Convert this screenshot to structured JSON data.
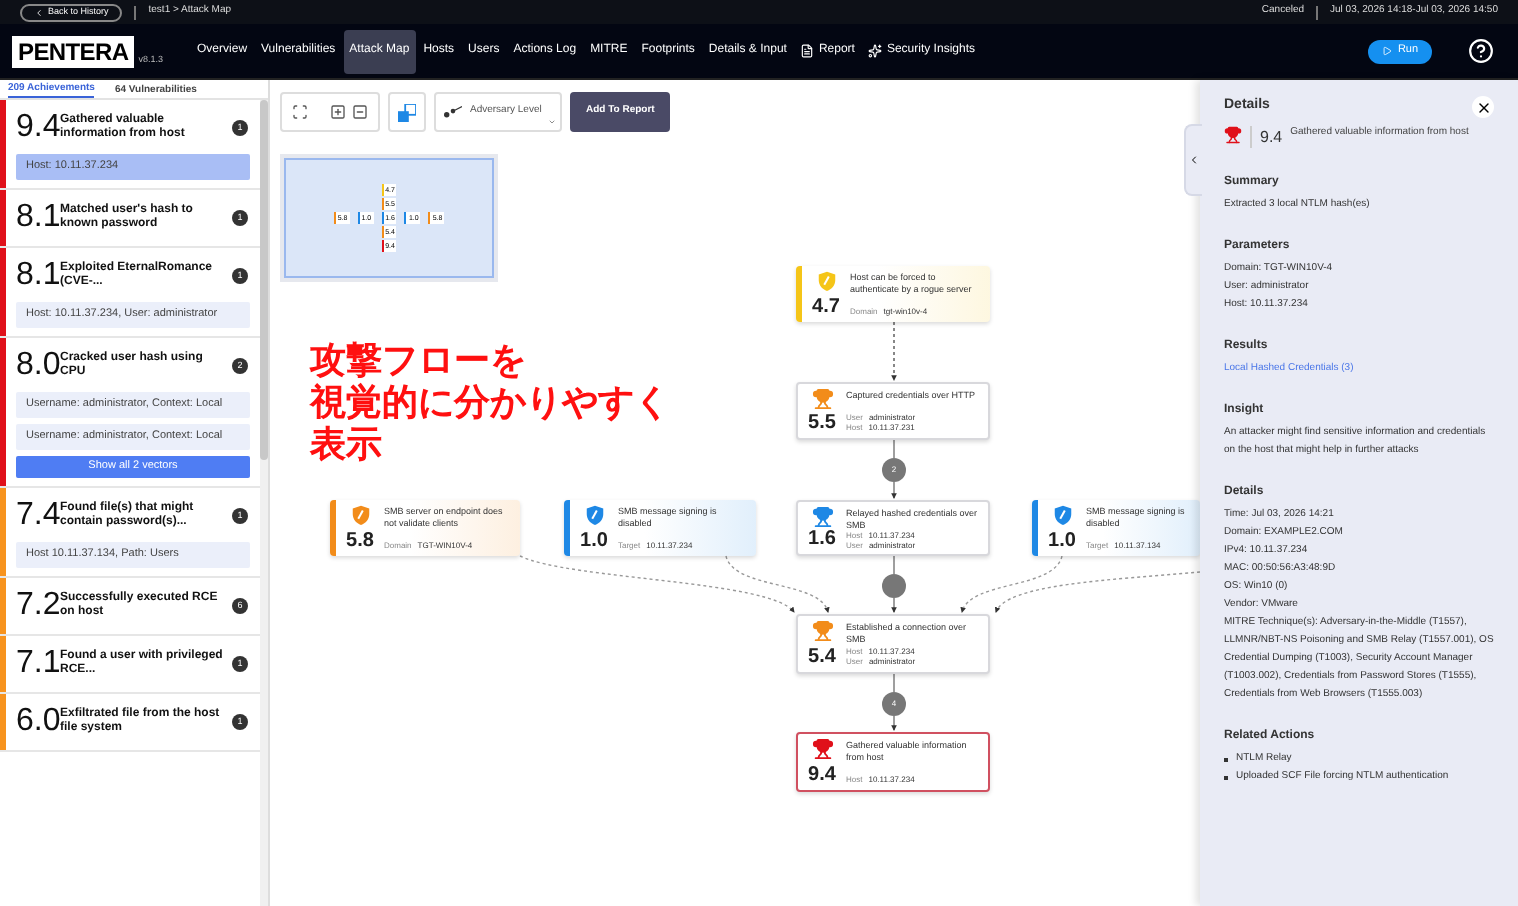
{
  "top_bar": {
    "back_button": "Back to History",
    "breadcrumb": "test1 > Attack Map",
    "status": "Canceled",
    "time_range": "Jul 03, 2026 14:18-Jul 03, 2026 14:50"
  },
  "nav": {
    "logo": "PENTERA",
    "version": "v8.1.3",
    "items": [
      {
        "label": "Overview",
        "selected": false,
        "kind": "plain"
      },
      {
        "label": "Vulnerabilities",
        "selected": false,
        "kind": "plain"
      },
      {
        "label": "Attack Map",
        "selected": true,
        "kind": "plain"
      },
      {
        "label": "Hosts",
        "selected": false,
        "kind": "plain"
      },
      {
        "label": "Users",
        "selected": false,
        "kind": "plain"
      },
      {
        "label": "Actions Log",
        "selected": false,
        "kind": "plain"
      },
      {
        "label": "MITRE",
        "selected": false,
        "kind": "plain"
      },
      {
        "label": "Footprints",
        "selected": false,
        "kind": "plain"
      },
      {
        "label": "Details & Input",
        "selected": false,
        "kind": "plain"
      },
      {
        "label": "Report",
        "selected": false,
        "kind": "document"
      },
      {
        "label": "Security Insights",
        "selected": false,
        "kind": "insights"
      }
    ],
    "run_button": "Run"
  },
  "side_tabs": [
    {
      "label": "209 Achievements",
      "selected": true
    },
    {
      "label": "64 Vulnerabilities",
      "selected": false
    }
  ],
  "achievements": [
    {
      "score": "9.4",
      "title": "Gathered valuable information from host",
      "count": "1",
      "color": "#e0101a",
      "vectors": [
        {
          "text": "Host: 10.11.37.234",
          "selected": true
        }
      ]
    },
    {
      "score": "8.1",
      "title": "Matched user's hash to known password",
      "count": "1",
      "color": "#e0101a"
    },
    {
      "score": "8.1",
      "title": "Exploited EternalRomance (CVE-...",
      "count": "1",
      "color": "#e0101a",
      "vectors": [
        {
          "text": "Host: 10.11.37.234, User: administrator",
          "selected": false
        }
      ]
    },
    {
      "score": "8.0",
      "title": "Cracked user hash using CPU",
      "count": "2",
      "color": "#e0101a",
      "vectors": [
        {
          "text": "Username: administrator, Context: Local",
          "selected": false
        },
        {
          "text": "Username: administrator, Context: Local",
          "selected": false
        }
      ],
      "show_all": "Show all 2 vectors"
    },
    {
      "score": "7.4",
      "title": "Found file(s) that might contain password(s)...",
      "count": "1",
      "color": "#f7931e",
      "vectors": [
        {
          "text": "Host 10.11.37.134, Path: Users",
          "selected": false
        }
      ]
    },
    {
      "score": "7.2",
      "title": "Successfully executed RCE on host",
      "count": "6",
      "color": "#f7931e"
    },
    {
      "score": "7.1",
      "title": "Found a user with privileged RCE...",
      "count": "1",
      "color": "#f7931e"
    },
    {
      "score": "6.0",
      "title": "Exfiltrated file from the host file system",
      "count": "1",
      "color": "#f7931e"
    }
  ],
  "toolbar": {
    "dropdown": "Adversary Level",
    "add_button": "Add To Report"
  },
  "minimap": [
    [
      {
        "score": "4.7",
        "color": "#f5c518"
      }
    ],
    [
      {
        "score": "5.5",
        "color": "#f28c1a"
      }
    ],
    [
      {
        "score": "5.8",
        "color": "#f28c1a"
      },
      {
        "score": "1.0",
        "color": "#1e88e5"
      },
      {
        "score": "1.6",
        "color": "#1e88e5"
      },
      {
        "score": "1.0",
        "color": "#1e88e5"
      },
      {
        "score": "5.8",
        "color": "#f28c1a"
      }
    ],
    [
      {
        "score": "5.4",
        "color": "#f28c1a"
      }
    ],
    [
      {
        "score": "9.4",
        "color": "#e0101a"
      }
    ]
  ],
  "annotation": [
    "攻撃フローを",
    "視覚的に分かりやすく",
    "表示"
  ],
  "graph": {
    "nodes": [
      {
        "kind": "vulnerability",
        "score": "4.7",
        "title": "Host can be forced to authenticate by a rogue server",
        "color": "#f5c518",
        "selected": false,
        "details": [
          {
            "label": "Domain",
            "value": "tgt-win10v-4"
          }
        ]
      },
      {
        "kind": "achievement",
        "score": "5.5",
        "title": "Captured credentials over HTTP",
        "color": "#f28c1a",
        "selected": false,
        "details": [
          {
            "label": "User",
            "value": "administrator"
          },
          {
            "label": "Host",
            "value": "10.11.37.231"
          }
        ]
      },
      {
        "kind": "vulnerability",
        "score": "5.8",
        "title": "SMB server on endpoint does not validate clients",
        "color": "#f28c1a",
        "selected": false,
        "details": [
          {
            "label": "Domain",
            "value": "TGT-WIN10V-4"
          }
        ]
      },
      {
        "kind": "vulnerability",
        "score": "1.0",
        "title": "SMB message signing is disabled",
        "color": "#1e88e5",
        "selected": false,
        "details": [
          {
            "label": "Target",
            "value": "10.11.37.234"
          }
        ]
      },
      {
        "kind": "achievement",
        "score": "1.6",
        "title": "Relayed hashed credentials over SMB",
        "color": "#1e88e5",
        "selected": false,
        "details": [
          {
            "label": "Host",
            "value": "10.11.37.234"
          },
          {
            "label": "User",
            "value": "administrator"
          }
        ]
      },
      {
        "kind": "vulnerability",
        "score": "1.0",
        "title": "SMB message signing is disabled",
        "color": "#1e88e5",
        "selected": false,
        "details": [
          {
            "label": "Target",
            "value": "10.11.37.134"
          }
        ]
      },
      {
        "kind": "achievement",
        "score": "5.4",
        "title": "Established a connection over SMB",
        "color": "#f28c1a",
        "selected": false,
        "details": [
          {
            "label": "Host",
            "value": "10.11.37.234"
          },
          {
            "label": "User",
            "value": "administrator"
          }
        ]
      },
      {
        "kind": "achievement",
        "score": "9.4",
        "title": "Gathered valuable information from host",
        "color": "#e0101a",
        "selected": true,
        "details": [
          {
            "label": "Host",
            "value": "10.11.37.234"
          }
        ]
      }
    ],
    "steps": [
      "2",
      "4"
    ]
  },
  "details_panel": {
    "title": "Details",
    "score": "9.4",
    "heading": "Gathered valuable information from host",
    "color": "#e0101a",
    "sections": [
      {
        "kind": "text",
        "title": "Summary",
        "lines": [
          "Extracted 3 local NTLM hash(es)"
        ]
      },
      {
        "kind": "text",
        "title": "Parameters",
        "lines": [
          "Domain: TGT-WIN10V-4",
          "User: administrator",
          "Host: 10.11.37.234"
        ]
      },
      {
        "kind": "link",
        "title": "Results",
        "lines": [
          "Local Hashed Credentials (3)"
        ]
      },
      {
        "kind": "text",
        "title": "Insight",
        "lines": [
          "An attacker might find sensitive information and credentials on the host that might help in further attacks"
        ]
      },
      {
        "kind": "text",
        "title": "Details",
        "lines": [
          "Time: Jul 03, 2026 14:21",
          "Domain: EXAMPLE2.COM",
          "IPv4: 10.11.37.234",
          "MAC: 00:50:56:A3:48:9D",
          "OS: Win10 (0)",
          "Vendor: VMware",
          "MITRE Technique(s): Adversary-in-the-Middle (T1557), LLMNR/NBT-NS Poisoning and SMB Relay (T1557.001), OS Credential Dumping (T1003), Security Account Manager (T1003.002), Credentials from Password Stores (T1555), Credentials from Web Browsers (T1555.003)"
        ]
      },
      {
        "kind": "bullets",
        "title": "Related Actions",
        "lines": [
          "NTLM Relay",
          "Uploaded SCF File forcing NTLM authentication"
        ]
      }
    ]
  }
}
